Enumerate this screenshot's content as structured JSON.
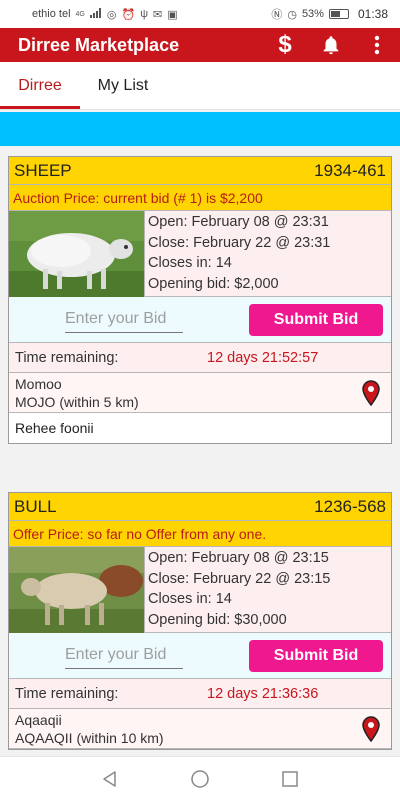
{
  "status_bar": {
    "carrier": "ethio tel",
    "signal": "4G",
    "battery_percent": "53%",
    "time": "01:38"
  },
  "app_bar": {
    "title": "Dirree Marketplace",
    "actions": [
      "dollar-icon",
      "bell-icon",
      "more-vert-icon"
    ],
    "background": "#c8161c"
  },
  "tabs": [
    {
      "label": "Dirree",
      "active": true
    },
    {
      "label": "My List",
      "active": false
    }
  ],
  "banner_color": "#00bfff",
  "listings": [
    {
      "category": "SHEEP",
      "code": "1934-461",
      "price_line": "Auction Price:  current bid (# 1) is  $2,200",
      "open": "Open: February 08 @ 23:31",
      "close": "Close: February 22 @ 23:31",
      "closes_in": "Closes in: 14",
      "opening_bid": "Opening bid:  $2,000",
      "bid_placeholder": "Enter your Bid",
      "submit_label": "Submit Bid",
      "time_label": "Time remaining:",
      "time_value": "12 days 21:52:57",
      "location_1": "Momoo",
      "location_2": "MOJO  (within 5 km)",
      "description": "Rehee foonii",
      "photo": "sheep-photo"
    },
    {
      "category": "BULL",
      "code": "1236-568",
      "price_line": "Offer Price:   so far no Offer from any one.",
      "open": "Open: February 08 @ 23:15",
      "close": "Close: February 22 @ 23:15",
      "closes_in": "Closes in: 14",
      "opening_bid": "Opening bid:  $30,000",
      "bid_placeholder": "Enter your Bid",
      "submit_label": "Submit Bid",
      "time_label": "Time remaining:",
      "time_value": "12 days 21:36:36",
      "location_1": "Aqaaqii",
      "location_2": "AQAAQII  (within 10 km)",
      "description": "",
      "photo": "bull-photo"
    }
  ],
  "nav_bar": [
    "back-icon",
    "home-icon",
    "recents-icon"
  ]
}
